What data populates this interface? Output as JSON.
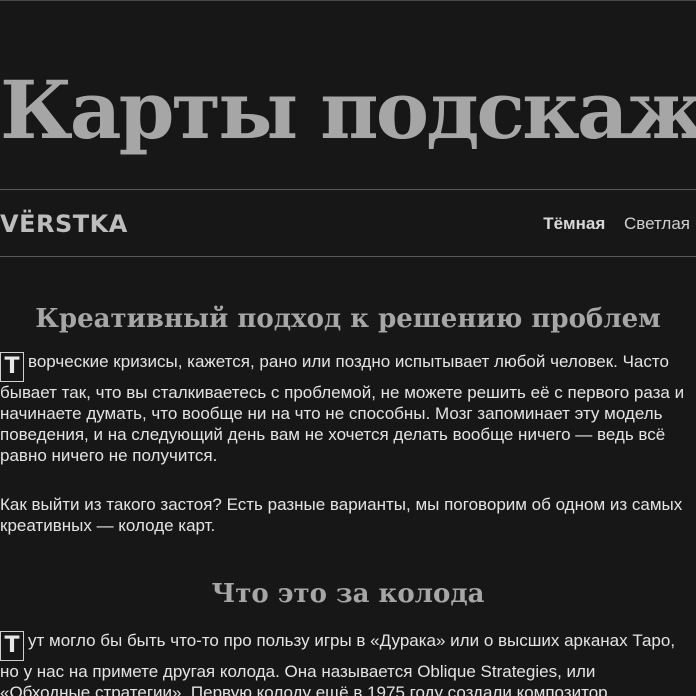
{
  "hero": {
    "title": "Карты подскажут"
  },
  "nav": {
    "logo": "VËRSTKA",
    "theme_dark": "Тёмная",
    "theme_light": "Светлая"
  },
  "article": {
    "section1": {
      "title": "Креативный подход к решению проблем",
      "p1_dropcap": "Т",
      "p1_text": "ворческие кризисы, кажется, рано или поздно испытывает любой человек. Часто бывает так, что вы сталкиваетесь с проблемой, не можете решить её с первого раза и начинаете думать, что вообще ни на что не способны. Мозг запоминает эту модель поведения, и на следующий день вам не хочется делать вообще ничего — ведь всё равно ничего не получится.",
      "p2_text": "Как выйти из такого застоя? Есть разные варианты, мы поговорим об одном из самых креативных — колоде карт."
    },
    "section2": {
      "title": "Что это за колода",
      "p1_dropcap": "Т",
      "p1_text": "ут могло бы быть что-то про пользу игры в «Дурака» или о высших арканах Таро, но у нас на примете другая колода. Она называется Oblique Strategies, или «Обходные стратегии». Первую колоду ещё в 1975 году создали композитор"
    }
  },
  "colors": {
    "background": "#171717",
    "heading": "#a6a6a6",
    "text": "#e4e4e4",
    "divider": "#5a5a5a"
  }
}
